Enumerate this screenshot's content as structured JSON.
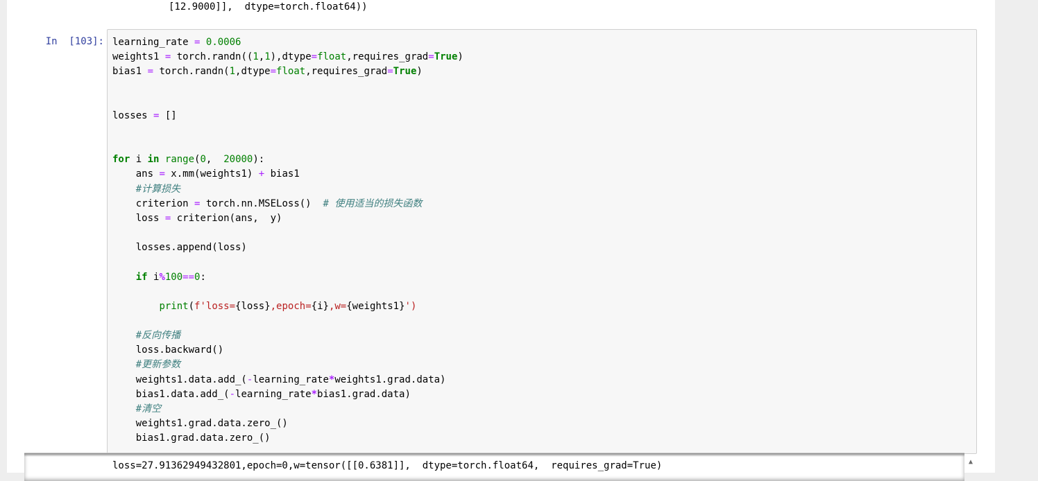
{
  "previous_output": {
    "line": "[12.9000]],  dtype=torch.float64))"
  },
  "cell": {
    "prompt": "In  [103]:",
    "lines": {
      "l1": {
        "a": "learning_rate ",
        "b": "=",
        "c": " ",
        "d": "0.0006"
      },
      "l2": {
        "a": "weights1 ",
        "b": "=",
        "c": " torch.randn((",
        "d": "1",
        "e": ",",
        "f": "1",
        "g": "),dtype",
        "h": "=",
        "i": "float",
        "j": ",requires_grad",
        "k": "=",
        "l": "True",
        "m": ")"
      },
      "l3": {
        "a": "bias1 ",
        "b": "=",
        "c": " torch.randn(",
        "d": "1",
        "e": ",dtype",
        "f": "=",
        "g": "float",
        "h": ",requires_grad",
        "i": "=",
        "j": "True",
        "k": ")"
      },
      "l6": {
        "a": "losses ",
        "b": "=",
        "c": " []"
      },
      "l9": {
        "a": "for",
        "b": " i ",
        "c": "in",
        "d": " ",
        "e": "range",
        "f": "(",
        "g": "0",
        "h": ",  ",
        "i": "20000",
        "j": "):"
      },
      "l10": {
        "a": "    ans ",
        "b": "=",
        "c": " x.mm(weights1) ",
        "d": "+",
        "e": " bias1"
      },
      "l11": {
        "a": "    ",
        "b": "#计算损失"
      },
      "l12": {
        "a": "    criterion ",
        "b": "=",
        "c": " torch.nn.MSELoss()  ",
        "d": "# 使用适当的损失函数"
      },
      "l13": {
        "a": "    loss ",
        "b": "=",
        "c": " criterion(ans,  y)"
      },
      "l15": {
        "a": "    losses.append(loss)"
      },
      "l17": {
        "a": "    ",
        "b": "if",
        "c": " i",
        "d": "%",
        "e": "100",
        "f": "==",
        "g": "0",
        "h": ":"
      },
      "l19": {
        "a": "        ",
        "b": "print",
        "c": "(",
        "d": "f'loss=",
        "e": "{loss}",
        "f": ",epoch=",
        "g": "{i}",
        "h": ",w=",
        "i": "{weights1}",
        "j": "')"
      },
      "l21": {
        "a": "    ",
        "b": "#反向传播"
      },
      "l22": {
        "a": "    loss.backward()"
      },
      "l23": {
        "a": "    ",
        "b": "#更新参数"
      },
      "l24": {
        "a": "    weights1.data.add_(",
        "b": "-",
        "c": "learning_rate",
        "d": "*",
        "e": "weights1.grad.data)"
      },
      "l25": {
        "a": "    bias1.data.add_(",
        "b": "-",
        "c": "learning_rate",
        "d": "*",
        "e": "bias1.grad.data)"
      },
      "l26": {
        "a": "    ",
        "b": "#清空"
      },
      "l27": {
        "a": "    weights1.grad.data.zero_()"
      },
      "l28": {
        "a": "    bias1.grad.data.zero_()"
      }
    }
  },
  "output": {
    "line": "loss=27.91362949432801,epoch=0,w=tensor([[0.6381]],  dtype=torch.float64,  requires_grad=True)"
  },
  "scrollbar": {
    "up_arrow": "▲"
  }
}
